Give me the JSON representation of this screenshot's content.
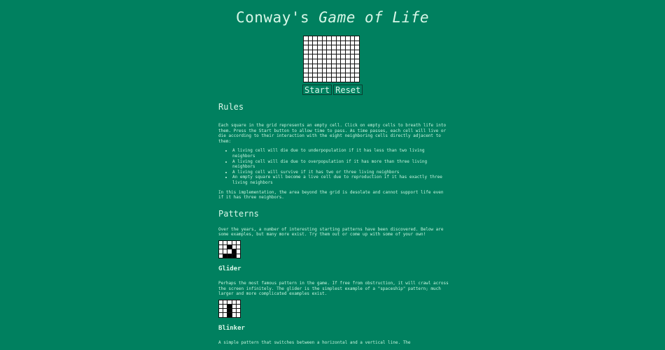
{
  "title": {
    "prefix": "Conway's ",
    "emphasis": "Game of Life"
  },
  "controls": {
    "start_label": "Start",
    "reset_label": "Reset"
  },
  "rules": {
    "heading": "Rules",
    "intro": "Each square in the grid represents an empty cell. Click on empty cells to breath life into them. Press the Start button to allow time to pass. As time passes, each cell will live or die according to their interaction with the eight neighboring cells directly adjacent to them:",
    "items": [
      "A living cell will die due to underpopulation if it has less than two living neighbors",
      "A living cell will die due to overpopulation if it has more than three living neighbors",
      "A living cell will survive if it has two or three living neighbors",
      "An empty square will become a live cell due to reproduction if it has exactly three living neighbors"
    ],
    "note": "In this implementation, the area beyond the grid is desolate and cannot support life even if it has three neighbors."
  },
  "patterns": {
    "heading": "Patterns",
    "intro": "Over the years, a number of interesting starting patterns have been discovered. Below are some examples, but many more exist. Try them out or come up with some of your own!",
    "items": [
      {
        "name": "Glider",
        "description": "Perhaps the most famous pattern in the game. If free from obstruction, it will crawl across the screen infinitely. The glider is the simplest example of a \"spaceship\" pattern; much larger and more complicated examples exist.",
        "live_cells": [
          [
            1,
            2
          ],
          [
            2,
            3
          ],
          [
            3,
            1
          ],
          [
            3,
            2
          ],
          [
            3,
            3
          ]
        ]
      },
      {
        "name": "Blinker",
        "description": "A simple pattern that switches between a horizontal and a vertical line. The",
        "live_cells": [
          [
            1,
            2
          ],
          [
            2,
            2
          ],
          [
            3,
            2
          ]
        ]
      }
    ]
  }
}
